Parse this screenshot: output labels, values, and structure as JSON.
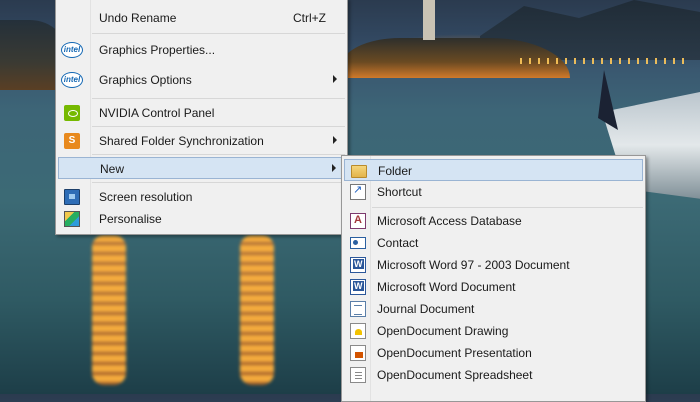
{
  "desktop_menu": {
    "items": [
      {
        "label": "Undo Rename",
        "shortcut": "Ctrl+Z",
        "icon": "none"
      },
      {
        "label": "Graphics Properties...",
        "icon": "intel-icon",
        "icon_text": "intel"
      },
      {
        "label": "Graphics Options",
        "icon": "intel-icon",
        "icon_text": "intel"
      },
      {
        "label": "NVIDIA Control Panel",
        "icon": "nvidia-icon"
      },
      {
        "label": "Shared Folder Synchronization",
        "icon": "sync-icon",
        "icon_text": "S"
      },
      {
        "label": "New",
        "icon": "none"
      },
      {
        "label": "Screen resolution",
        "icon": "screen-resolution-icon"
      },
      {
        "label": "Personalise",
        "icon": "personalise-icon"
      }
    ]
  },
  "new_submenu": {
    "items": [
      {
        "label": "Folder",
        "icon": "folder-icon"
      },
      {
        "label": "Shortcut",
        "icon": "shortcut-icon"
      },
      {
        "label": "Microsoft Access Database",
        "icon": "access-database-icon"
      },
      {
        "label": "Contact",
        "icon": "contact-icon"
      },
      {
        "label": "Microsoft Word 97 - 2003 Document",
        "icon": "word-97-document-icon"
      },
      {
        "label": "Microsoft Word Document",
        "icon": "word-document-icon"
      },
      {
        "label": "Journal Document",
        "icon": "journal-document-icon"
      },
      {
        "label": "OpenDocument Drawing",
        "icon": "opendocument-drawing-icon"
      },
      {
        "label": "OpenDocument Presentation",
        "icon": "opendocument-presentation-icon"
      },
      {
        "label": "OpenDocument Spreadsheet",
        "icon": "opendocument-spreadsheet-icon"
      }
    ]
  },
  "colors": {
    "menu_background": "#f0f0f0",
    "highlight_background": "#d5e4f3",
    "highlight_border": "#9ab4d3"
  }
}
